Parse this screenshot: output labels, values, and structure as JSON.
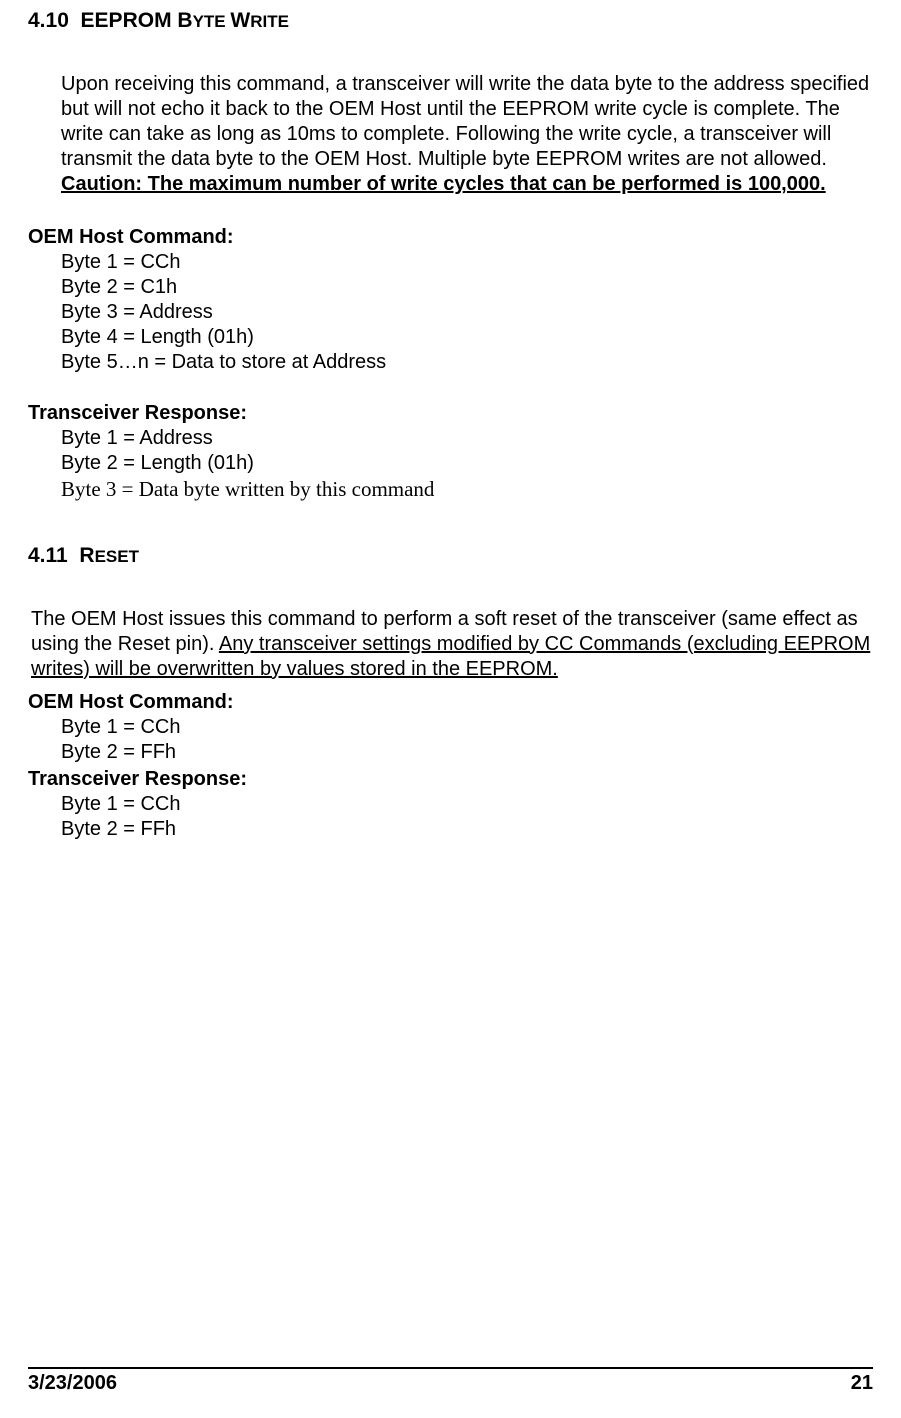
{
  "section410": {
    "number": "4.10",
    "title_main": "EEPROM B",
    "title_sc": "YTE ",
    "title_main2": "W",
    "title_sc2": "RITE",
    "body_plain": "Upon receiving this command, a transceiver will write the data byte to the address specified but will not echo it back to the OEM Host until the EEPROM write cycle is complete.   The write can take as long as 10ms to complete.  Following the write cycle, a transceiver will transmit the data byte to the OEM Host. Multiple byte EEPROM writes are not allowed. ",
    "body_caution": "Caution: The maximum number of write cycles that can be performed is 100,000.",
    "host_label": "OEM Host Command:",
    "host_bytes": [
      "Byte 1 = CCh",
      "Byte 2 = C1h",
      "Byte 3 = Address",
      "Byte 4 = Length (01h)",
      "Byte 5…n = Data to store at Address"
    ],
    "resp_label": "Transceiver Response:",
    "resp_bytes_sans": [
      "Byte 1 = Address",
      "Byte 2 = Length (01h)"
    ],
    "resp_byte_serif": "Byte 3 = Data byte written by this command"
  },
  "section411": {
    "number": "4.11",
    "title_main": "R",
    "title_sc": "ESET",
    "body_plain": "The OEM Host issues this command to perform a soft reset of the transceiver (same effect as using the Reset pin).  ",
    "body_underline": "Any transceiver settings modified by CC Commands (excluding EEPROM writes) will be overwritten by values stored in the EEPROM.",
    "host_label": "OEM Host Command:",
    "host_bytes": [
      "Byte 1 = CCh",
      "Byte 2 = FFh"
    ],
    "resp_label": "Transceiver Response:",
    "resp_bytes": [
      "Byte 1 = CCh",
      "Byte 2 = FFh"
    ]
  },
  "footer": {
    "date": "3/23/2006",
    "page": "21"
  }
}
